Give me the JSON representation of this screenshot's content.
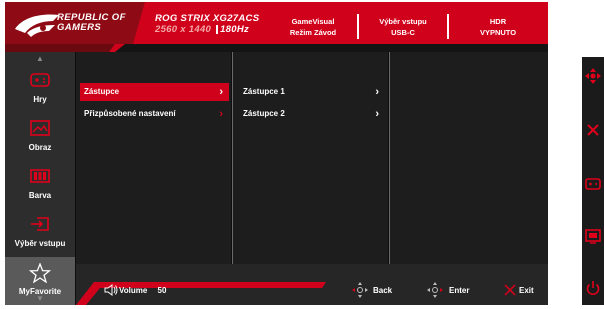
{
  "header": {
    "brand_line1": "REPUBLIC OF",
    "brand_line2": "GAMERS",
    "model": "ROG STRIX XG27ACS",
    "resolution": "2560 x 1440",
    "refresh": "180Hz",
    "status": [
      {
        "title": "GameVisual",
        "value": "Režim Závod"
      },
      {
        "title": "Výběr vstupu",
        "value": "USB-C"
      },
      {
        "title": "HDR",
        "value": "VYPNUTO"
      }
    ]
  },
  "sidebar": {
    "items": [
      {
        "label": "Hry",
        "icon": "gamepad-icon"
      },
      {
        "label": "Obraz",
        "icon": "image-icon"
      },
      {
        "label": "Barva",
        "icon": "color-bars-icon"
      },
      {
        "label": "Výběr vstupu",
        "icon": "input-icon"
      },
      {
        "label": "MyFavorite",
        "icon": "star-icon"
      }
    ],
    "active_index": 4
  },
  "menu": {
    "level1": [
      {
        "label": "Zástupce",
        "selected": true
      },
      {
        "label": "Přizpůsobené nastavení",
        "selected": false
      }
    ],
    "level2": [
      {
        "label": "Zástupce 1"
      },
      {
        "label": "Zástupce 2"
      }
    ]
  },
  "footer": {
    "volume_label": "Volume",
    "volume_value": "50",
    "back_label": "Back",
    "enter_label": "Enter",
    "exit_label": "Exit"
  },
  "keys": [
    "dpad-icon",
    "close-icon",
    "gamepad-icon",
    "gameplus-icon",
    "power-icon"
  ],
  "colors": {
    "accent": "#d0021b",
    "panel": "#1d1d1d",
    "sidebar": "#2d2d2d"
  }
}
